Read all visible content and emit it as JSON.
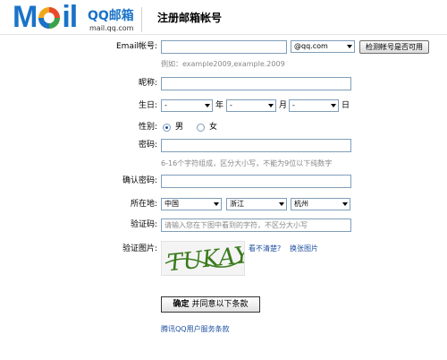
{
  "header": {
    "logo_m": "M",
    "logo_il": "il",
    "brand_name": "QQ邮箱",
    "brand_domain": "mail.qq.com",
    "page_title": "注册邮箱帐号"
  },
  "form": {
    "email": {
      "label": "Email帐号:",
      "value": "",
      "domain_selected": "@qq.com",
      "check_button": "检测帐号是否可用",
      "example": "例如：example2009,example.2009"
    },
    "nickname": {
      "label": "昵称:",
      "value": ""
    },
    "birthday": {
      "label": "生日:",
      "year_value": "-",
      "year_unit": "年",
      "month_value": "-",
      "month_unit": "月",
      "day_value": "-",
      "day_unit": "日"
    },
    "gender": {
      "label": "性别:",
      "male": "男",
      "female": "女",
      "selected": "男"
    },
    "password": {
      "label": "密码:",
      "value": "",
      "hint": "6-16个字符组成，区分大小写，不能为9位以下纯数字"
    },
    "confirm_password": {
      "label": "确认密码:",
      "value": ""
    },
    "location": {
      "label": "所在地:",
      "country": "中国",
      "province": "浙江",
      "city": "杭州"
    },
    "verification_code": {
      "label": "验证码:",
      "placeholder": "请输入您在下图中看到的字符，不区分大小写"
    },
    "captcha": {
      "label": "验证图片:",
      "captcha_text": "TUKAY",
      "cant_see": "看不清楚?",
      "change": "换张图片"
    },
    "submit": {
      "label_bold": "确定",
      "label_rest": "并同意以下条款"
    },
    "terms_link": "腾讯QQ用户服务条款"
  },
  "colors": {
    "brand_blue": "#1a73c8",
    "link_blue": "#1c4fa0",
    "input_border": "#7f9db9",
    "captcha_green": "#3a7a1c"
  }
}
